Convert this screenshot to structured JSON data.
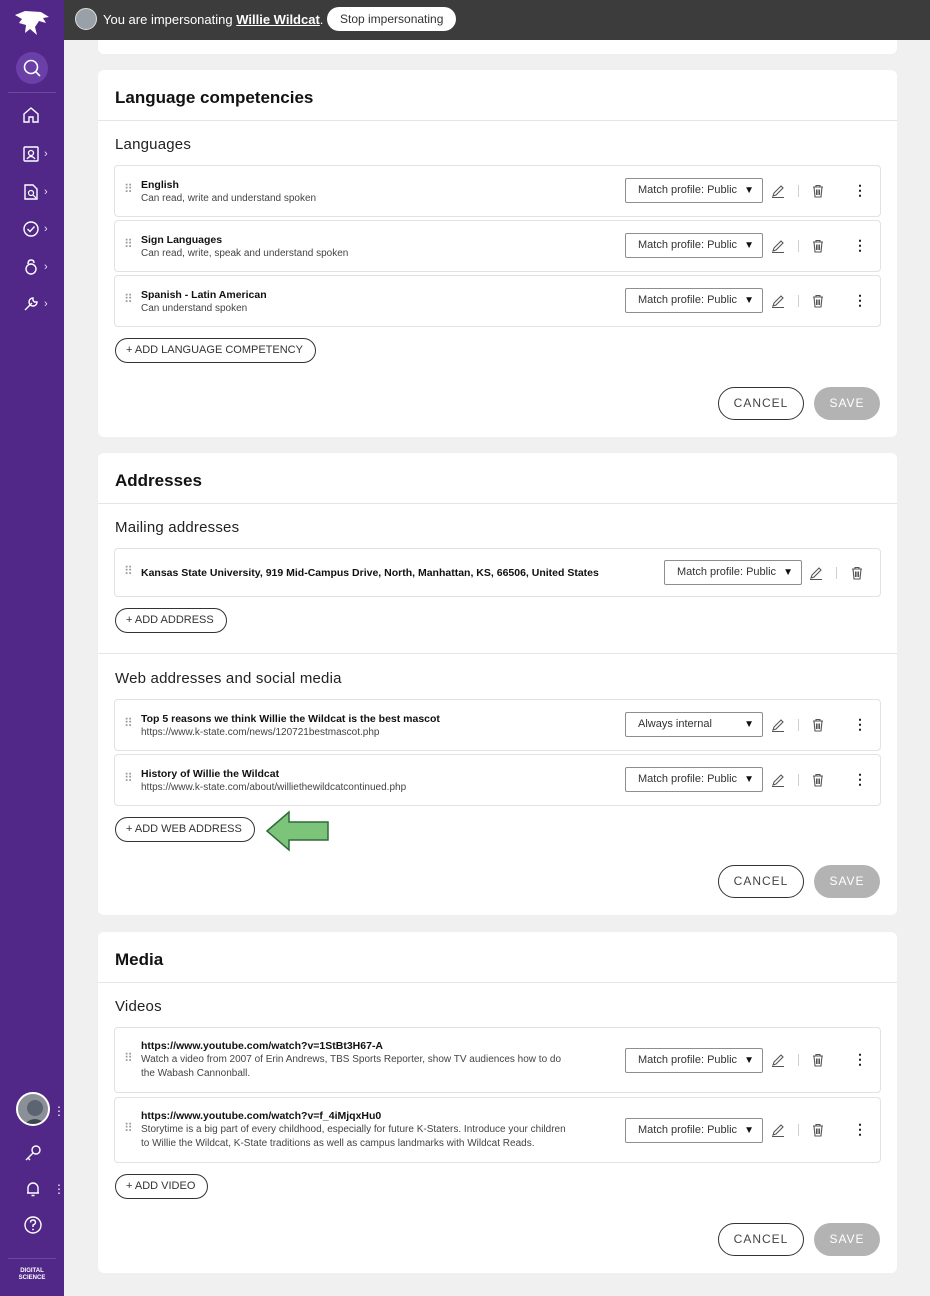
{
  "impersonation": {
    "prefix": "You are impersonating",
    "user": "Willie Wildcat",
    "suffix": ".",
    "stop_label": "Stop impersonating"
  },
  "sidebar": {
    "footer_line1": "DIGITAL",
    "footer_line2": "SCIENCE",
    "icons": [
      "home-icon",
      "profile-icon",
      "search-document-icon",
      "verified-icon",
      "access-icon",
      "tools-icon",
      "key-icon",
      "bell-icon",
      "help-icon"
    ]
  },
  "language": {
    "title": "Language competencies",
    "subtitle": "Languages",
    "items": [
      {
        "name": "English",
        "detail": "Can read, write and understand spoken",
        "visibility": "Match profile: Public"
      },
      {
        "name": "Sign Languages",
        "detail": "Can read, write, speak and understand spoken",
        "visibility": "Match profile: Public"
      },
      {
        "name": "Spanish - Latin American",
        "detail": "Can understand spoken",
        "visibility": "Match profile: Public"
      }
    ],
    "add_label": "ADD LANGUAGE COMPETENCY",
    "cancel_label": "CANCEL",
    "save_label": "SAVE"
  },
  "addresses": {
    "title": "Addresses",
    "mailing_title": "Mailing addresses",
    "mailing_items": [
      {
        "address": "Kansas State University, 919 Mid-Campus Drive, North, Manhattan, KS, 66506, United States",
        "visibility": "Match profile: Public"
      }
    ],
    "add_address_label": "ADD ADDRESS",
    "web_title": "Web addresses and social media",
    "web_items": [
      {
        "title": "Top 5 reasons we think Willie the Wildcat is the best mascot",
        "url": "https://www.k-state.com/news/120721bestmascot.php",
        "visibility": "Always internal"
      },
      {
        "title": "History of Willie the Wildcat",
        "url": "https://www.k-state.com/about/williethewildcatcontinued.php",
        "visibility": "Match profile: Public"
      }
    ],
    "add_web_label": "ADD WEB ADDRESS",
    "cancel_label": "CANCEL",
    "save_label": "SAVE"
  },
  "media": {
    "title": "Media",
    "subtitle": "Videos",
    "items": [
      {
        "url": "https://www.youtube.com/watch?v=1StBt3H67-A",
        "desc1": "Watch a video from 2007 of Erin Andrews, TBS Sports Reporter, show TV audiences how to do",
        "desc2": "the Wabash Cannonball.",
        "visibility": "Match profile: Public"
      },
      {
        "url": "https://www.youtube.com/watch?v=f_4iMjqxHu0",
        "desc1": "Storytime is a big part of every childhood, especially for future K-Staters. Introduce your children",
        "desc2": "to Willie the Wildcat, K-State traditions as well as campus landmarks with Wildcat Reads.",
        "visibility": "Match profile: Public"
      }
    ],
    "add_label": "ADD VIDEO",
    "cancel_label": "CANCEL",
    "save_label": "SAVE"
  },
  "colors": {
    "sidebar": "#512888",
    "topbar": "#3c3c3c",
    "arrow": "#7cc47a",
    "save_disabled": "#b3b3b3"
  }
}
